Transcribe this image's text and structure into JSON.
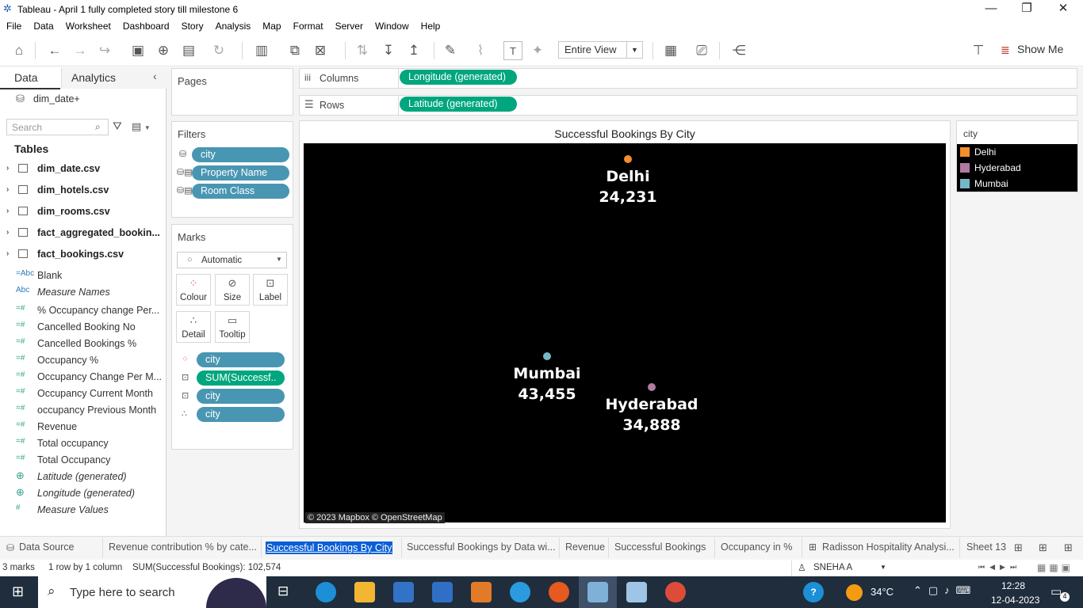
{
  "window": {
    "title": "Tableau - April 1 fully completed story till milestone 6",
    "minimize": "—",
    "restore": "❐",
    "close": "✕"
  },
  "menu": [
    "File",
    "Data",
    "Worksheet",
    "Dashboard",
    "Story",
    "Analysis",
    "Map",
    "Format",
    "Server",
    "Window",
    "Help"
  ],
  "toolbar": {
    "fit_value": "Entire View",
    "show_me": "Show Me"
  },
  "data_pane": {
    "tabs": {
      "data": "Data",
      "analytics": "Analytics"
    },
    "datasource": "dim_date+",
    "search_placeholder": "Search",
    "tables_heading": "Tables",
    "tables": [
      "dim_date.csv",
      "dim_hotels.csv",
      "dim_rooms.csv",
      "fact_aggregated_bookin...",
      "fact_bookings.csv"
    ],
    "fields": [
      {
        "icon": "=Abc",
        "name": "Blank",
        "italic": false
      },
      {
        "icon": "Abc",
        "name": "Measure Names",
        "italic": true
      },
      {
        "icon": "=#",
        "name": "% Occupancy change Per...",
        "italic": false
      },
      {
        "icon": "=#",
        "name": "Cancelled Booking No",
        "italic": false
      },
      {
        "icon": "=#",
        "name": "Cancelled Bookings %",
        "italic": false
      },
      {
        "icon": "=#",
        "name": "Occupancy %",
        "italic": false
      },
      {
        "icon": "=#",
        "name": "Occupancy Change Per M...",
        "italic": false
      },
      {
        "icon": "=#",
        "name": "Occupancy Current Month",
        "italic": false
      },
      {
        "icon": "=#",
        "name": "occupancy Previous Month",
        "italic": false
      },
      {
        "icon": "=#",
        "name": "Revenue",
        "italic": false
      },
      {
        "icon": "=#",
        "name": "Total occupancy",
        "italic": false
      },
      {
        "icon": "=#",
        "name": "Total Occupancy",
        "italic": false
      },
      {
        "icon": "globe",
        "name": "Latitude (generated)",
        "italic": true
      },
      {
        "icon": "globe",
        "name": "Longitude (generated)",
        "italic": true
      },
      {
        "icon": "#",
        "name": "Measure Values",
        "italic": true
      }
    ]
  },
  "shelves": {
    "pages": "Pages",
    "filters": {
      "title": "Filters",
      "items": [
        "city",
        "Property Name",
        "Room Class"
      ]
    },
    "marks": {
      "title": "Marks",
      "type": "Automatic",
      "buttons": [
        "Colour",
        "Size",
        "Label",
        "Detail",
        "Tooltip"
      ],
      "pills": [
        "city",
        "SUM(Successf..",
        "city",
        "city"
      ]
    },
    "columns": {
      "label": "Columns",
      "pill": "Longitude (generated)"
    },
    "rows": {
      "label": "Rows",
      "pill": "Latitude (generated)"
    }
  },
  "view": {
    "title": "Successful Bookings By City",
    "credit": "© 2023 Mapbox © OpenStreetMap",
    "points": [
      {
        "city": "Delhi",
        "value": "24,231",
        "color": "#f28e2b"
      },
      {
        "city": "Mumbai",
        "value": "43,455",
        "color": "#76b7c7"
      },
      {
        "city": "Hyderabad",
        "value": "34,888",
        "color": "#b07aa1"
      }
    ]
  },
  "legend": {
    "title": "city",
    "items": [
      {
        "label": "Delhi",
        "color": "#f28e2b"
      },
      {
        "label": "Hyderabad",
        "color": "#b07aa1"
      },
      {
        "label": "Mumbai",
        "color": "#76b7c7"
      }
    ]
  },
  "sheet_tabs": [
    "Data Source",
    "Revenue contribution % by cate...",
    "Successful Bookings By City",
    "Successful Bookings by Data wi...",
    "Revenue",
    "Successful Bookings",
    "Occupancy in %",
    "Radisson Hospitality Analysi...",
    "Sheet 13"
  ],
  "status": {
    "marks": "3 marks",
    "rows_cols": "1 row by 1 column",
    "sum": "SUM(Successful Bookings): 102,574",
    "user": "SNEHA A"
  },
  "taskbar": {
    "search_placeholder": "Type here to search",
    "temperature": "34°C",
    "time": "12:28",
    "date": "12-04-2023",
    "notifications": "4"
  }
}
